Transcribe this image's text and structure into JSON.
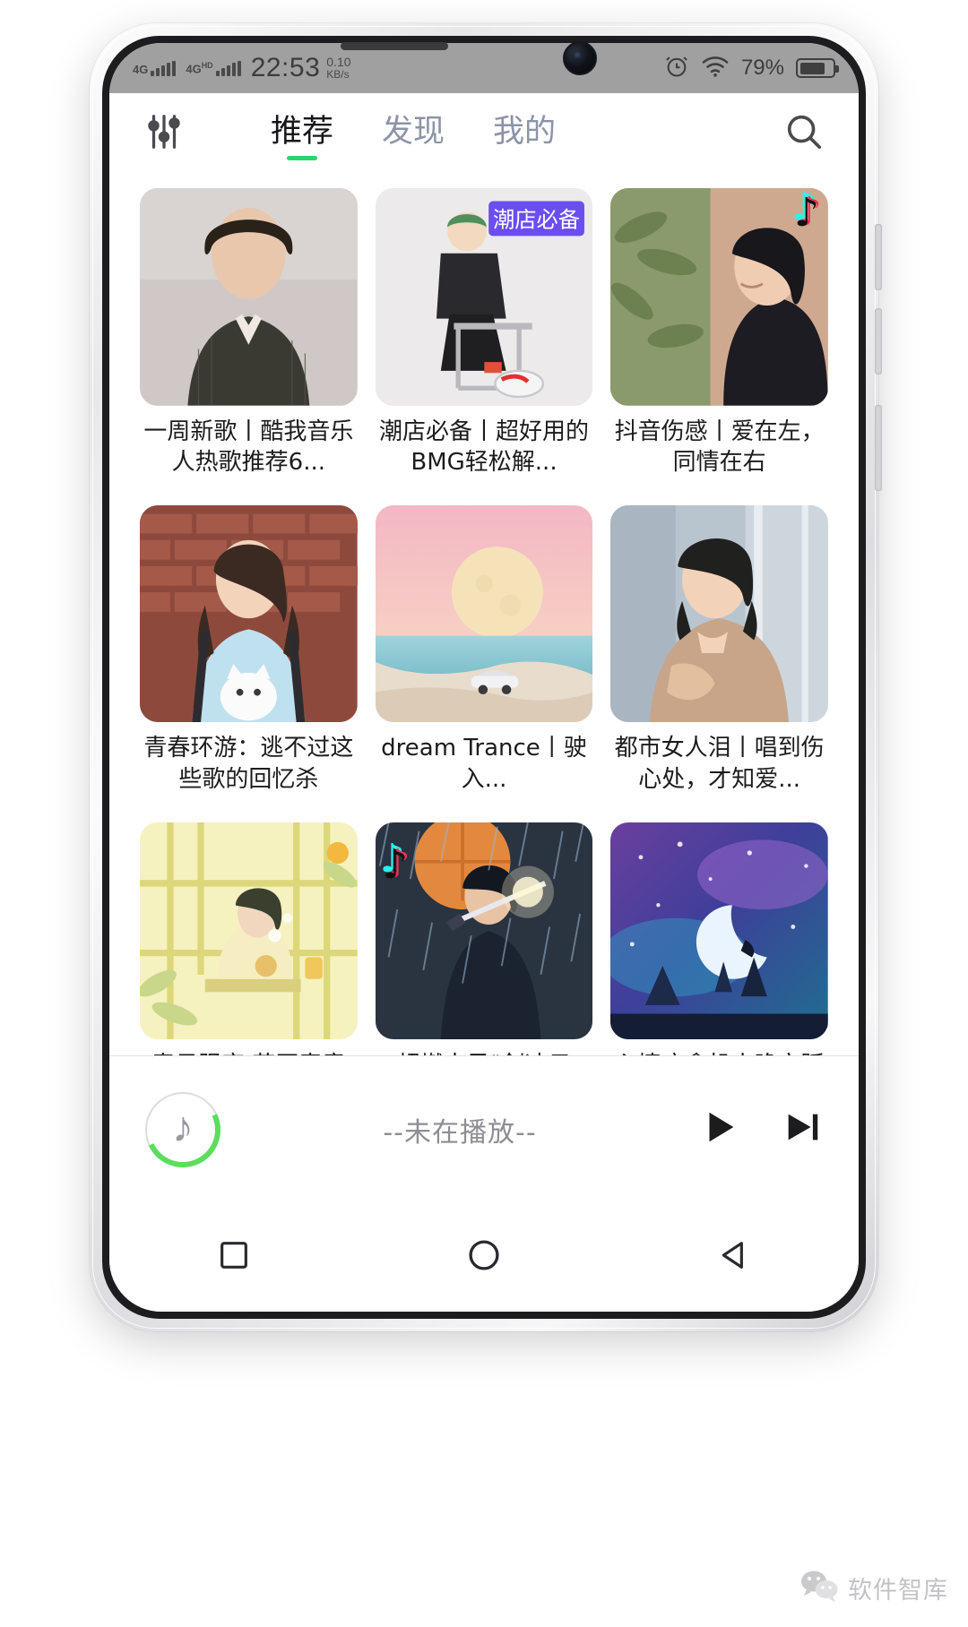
{
  "status_bar": {
    "network_type_1": "4G",
    "network_type_2": "4G",
    "network_suffix_2": "HD",
    "time": "22:53",
    "net_speed_value": "0.10",
    "net_speed_unit": "KB/s",
    "alarm_icon": "alarm-clock-icon",
    "wifi_icon": "wifi-icon",
    "battery_percent": "79%",
    "battery_level": 79,
    "background_color": "#a0a0a0"
  },
  "top_nav": {
    "equalizer_icon": "equalizer-icon",
    "search_icon": "search-icon",
    "active_indicator_color": "#2fd36b",
    "tabs": [
      {
        "label": "推荐",
        "active": true
      },
      {
        "label": "发现",
        "active": false
      },
      {
        "label": "我的",
        "active": false
      }
    ]
  },
  "cards": [
    {
      "title": "一周新歌丨酷我音乐人热歌推荐6...",
      "art": "portrait-man-suit",
      "badge": null
    },
    {
      "title": "潮店必备丨超好用的BMG轻松解...",
      "art": "illustration-man-chair",
      "badge": null
    },
    {
      "title": "抖音伤感丨爱在左，同情在右",
      "art": "photo-girl-plants",
      "badge": "douyin-icon"
    },
    {
      "title": "青春环游：逃不过这些歌的回忆杀",
      "art": "photo-girl-cat-brickwall",
      "badge": null
    },
    {
      "title": "dream Trance丨驶入...",
      "art": "illustration-moon-car-desert",
      "badge": null
    },
    {
      "title": "都市女人泪丨唱到伤心处，才知爱...",
      "art": "photo-woman-street",
      "badge": null
    },
    {
      "title": "春日限定·花开春意浓，舒适正当...",
      "art": "illustration-yellow-room",
      "badge": null
    },
    {
      "title": "超燃古风‖剑冲云霄，逐鹿天下",
      "art": "photo-swordsman-rain",
      "badge": "douyin-icon"
    },
    {
      "title": "心情疗愈机丨晚安踩着云、月亮贩...",
      "art": "illustration-night-moon-sky",
      "badge": null
    },
    {
      "title": "",
      "art": "illustration-colorful-abstract",
      "badge": null
    },
    {
      "title": "",
      "art": "photo-wet-hair-portrait",
      "badge": null
    },
    {
      "title": "",
      "art": "illustration-teal-neon",
      "badge": null
    }
  ],
  "player_bar": {
    "artwork_icon": "music-note-circle-icon",
    "title": "--未在播放--",
    "play_icon": "play-icon",
    "next_icon": "next-track-icon"
  },
  "android_nav": {
    "recents_icon": "square-recents-icon",
    "home_icon": "circle-home-icon",
    "back_icon": "triangle-back-icon"
  },
  "watermark": {
    "logo_icon": "wechat-icon",
    "text": "软件智库"
  }
}
